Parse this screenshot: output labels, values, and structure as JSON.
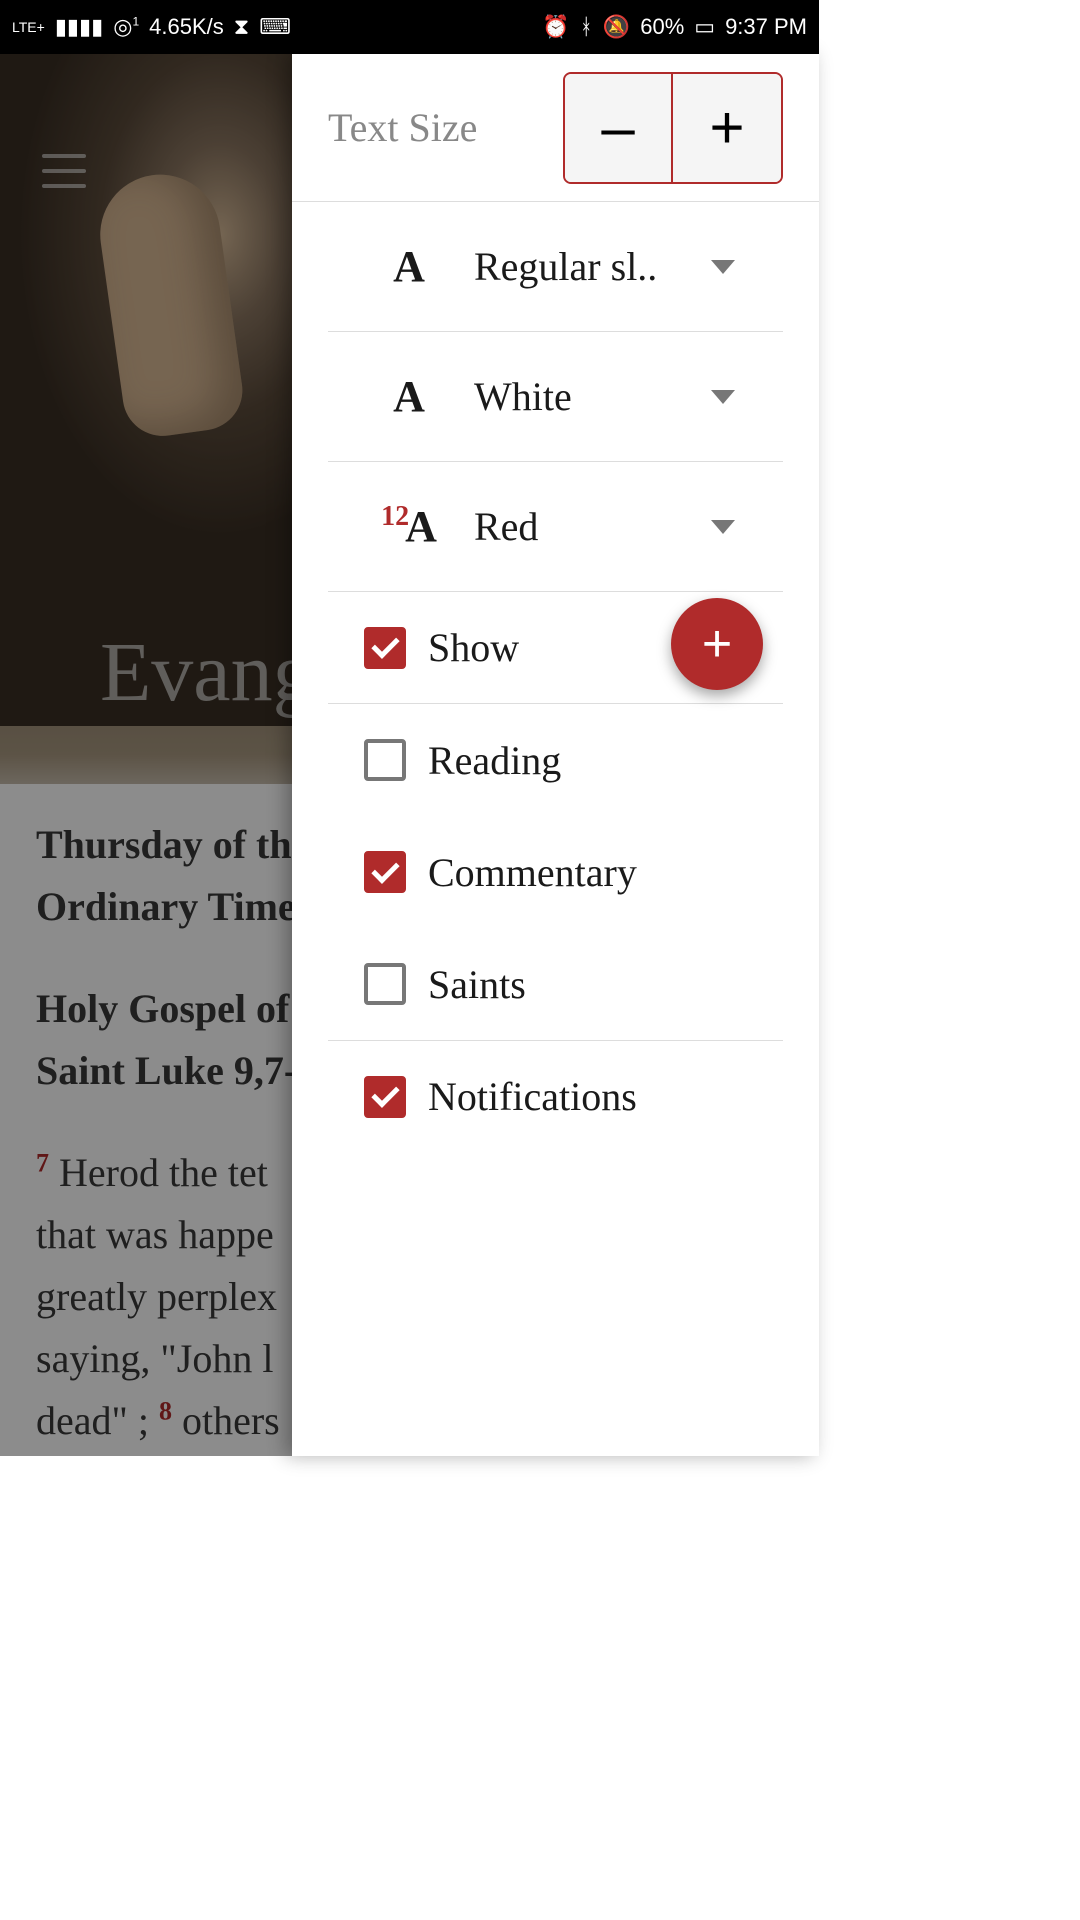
{
  "status_bar": {
    "signal_label": "LTE+",
    "speed": "4.65K/s",
    "battery_pct": "60%",
    "time": "9:37 PM"
  },
  "background": {
    "hero_title": "Evang",
    "heading": "Thursday of th\nOrdinary Time",
    "subheading": "Holy Gospel of\nSaint Luke 9,7-",
    "verse1_num": "7",
    "verse1_text": "Herod the tet that was happe greatly perplex saying, \"John l dead\" ; ",
    "verse2_num": "8",
    "verse2_text": "others"
  },
  "panel": {
    "text_size_label": "Text Size",
    "minus": "–",
    "plus": "+",
    "font_icon": "A",
    "font_value": "Regular sl..",
    "bg_icon": "A",
    "bg_value": "White",
    "accent_prefix": "12",
    "accent_icon": "A",
    "accent_value": "Red",
    "items": [
      {
        "label": "Show",
        "checked": true
      },
      {
        "label": "Reading",
        "checked": false
      },
      {
        "label": "Commentary",
        "checked": true
      },
      {
        "label": "Saints",
        "checked": false
      },
      {
        "label": "Notifications",
        "checked": true
      }
    ],
    "fab": "+"
  }
}
